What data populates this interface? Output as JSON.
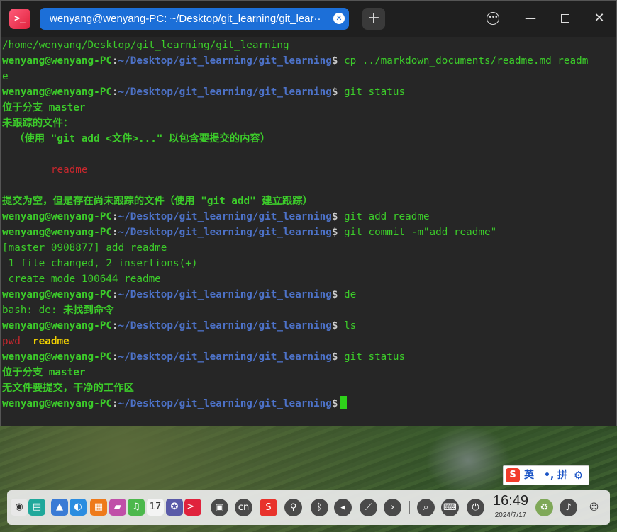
{
  "terminal": {
    "app_icon_glyph": ">_",
    "tab_title": "wenyang@wenyang-PC: ~/Desktop/git_learning/git_lear··",
    "new_tab_glyph": "+",
    "menu_glyph": "•••",
    "min_glyph": "—",
    "close_glyph": "✕",
    "prompt_user": "wenyang@wenyang-PC",
    "prompt_sep": ":",
    "prompt_path": "~/Desktop/git_learning/git_learning",
    "prompt_dollar": "$",
    "lines": {
      "l0": "/home/wenyang/Desktop/git_learning/git_learning",
      "l1_cmd": " cp ../markdown_documents/readme.md readm",
      "l2": "e",
      "l3_cmd": " git status",
      "l4": "位于分支 master",
      "l5": "未跟踪的文件：",
      "l6": "  （使用 \"git add <文件>...\" 以包含要提交的内容）",
      "l8": "        readme",
      "l10": "提交为空，但是存在尚未跟踪的文件（使用 \"git add\" 建立跟踪）",
      "l11_cmd": " git add readme",
      "l12_cmd": " git commit -m\"add readme\"",
      "l13": "[master 0908877] add readme",
      "l14": " 1 file changed, 2 insertions(+)",
      "l15": " create mode 100644 readme",
      "l16_cmd": " de",
      "l17_a": "bash: de: ",
      "l17_b": "未找到命令",
      "l18_cmd": " ls",
      "l19_a": "pwd",
      "l19_b": "readme",
      "l20_cmd": " git status",
      "l21": "位于分支 master",
      "l22": "无文件要提交，干净的工作区"
    }
  },
  "ime": {
    "logo": "S",
    "lang": "英",
    "punct": "•,",
    "pinyin": "拼",
    "gear": "⚙"
  },
  "dock": {
    "clock_time": "16:49",
    "clock_date": "2024/7/17",
    "apps": [
      {
        "icon": "launcher-icon",
        "glyph": "◉",
        "color": "#e8e8e8"
      },
      {
        "icon": "file-manager-icon",
        "glyph": "▤",
        "color": "#1fa89b"
      },
      {
        "icon": "app-store-icon",
        "glyph": "▲",
        "color": "#3a7bd5"
      },
      {
        "icon": "browser-icon",
        "glyph": "◐",
        "color": "#2a8de0"
      },
      {
        "icon": "package-icon",
        "glyph": "▦",
        "color": "#ee7a1a"
      },
      {
        "icon": "image-viewer-icon",
        "glyph": "▰",
        "color": "#c04fa8"
      },
      {
        "icon": "music-icon",
        "glyph": "♫",
        "color": "#4cb84c"
      },
      {
        "icon": "calendar-icon",
        "glyph": "17",
        "color": "#f4f4f4"
      },
      {
        "icon": "settings-icon",
        "glyph": "✪",
        "color": "#5a5aa8"
      },
      {
        "icon": "terminal-icon",
        "glyph": ">_",
        "color": "#e0223c"
      }
    ],
    "tray": [
      {
        "icon": "screenshot-icon",
        "glyph": "▣"
      },
      {
        "icon": "input-method-icon",
        "glyph": "cn"
      },
      {
        "icon": "sogou-icon",
        "glyph": "S"
      },
      {
        "icon": "usb-icon",
        "glyph": "⚲"
      },
      {
        "icon": "bluetooth-icon",
        "glyph": "ᛒ"
      },
      {
        "icon": "volume-icon",
        "glyph": "◂"
      },
      {
        "icon": "network-icon",
        "glyph": "⟋"
      },
      {
        "icon": "expand-tray-icon",
        "glyph": "›"
      },
      {
        "icon": "search-icon",
        "glyph": "⌕"
      },
      {
        "icon": "keyboard-icon",
        "glyph": "⌨"
      },
      {
        "icon": "power-icon",
        "glyph": "⏻"
      },
      {
        "icon": "trash-icon",
        "glyph": "♻"
      },
      {
        "icon": "notification-icon",
        "glyph": "♪"
      },
      {
        "icon": "assistant-icon",
        "glyph": "☺"
      }
    ]
  }
}
